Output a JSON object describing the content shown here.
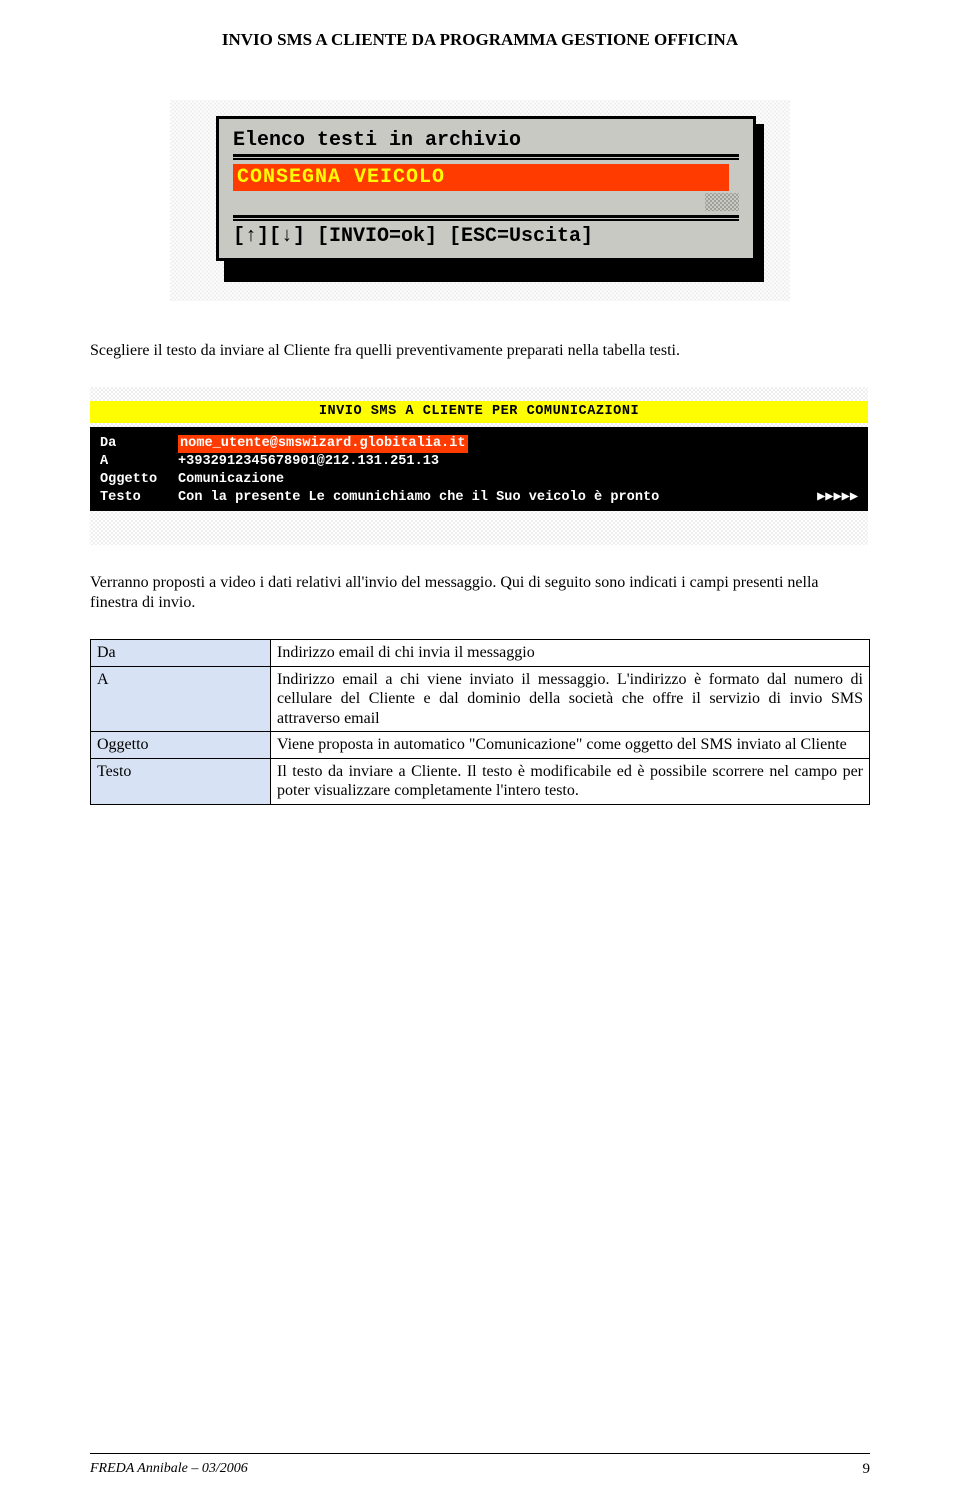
{
  "header": {
    "title": "INVIO SMS A CLIENTE DA PROGRAMMA GESTIONE OFFICINA"
  },
  "popup": {
    "title": "Elenco testi in archivio",
    "selected": "CONSEGNA VEICOLO",
    "instructions": "[↑][↓] [INVIO=ok] [ESC=Uscita]"
  },
  "para1": "Scegliere il testo da inviare al Cliente fra quelli preventivamente preparati nella tabella testi.",
  "form": {
    "banner": "INVIO SMS A CLIENTE PER COMUNICAZIONI",
    "rows": {
      "da": {
        "label": "Da",
        "value": "nome_utente@smswizard.globitalia.it"
      },
      "a": {
        "label": "A",
        "value": "+3932912345678901@212.131.251.13"
      },
      "oggetto": {
        "label": "Oggetto",
        "value": "Comunicazione"
      },
      "testo": {
        "label": "Testo",
        "value": "Con la presente Le comunichiamo che il Suo veicolo è pronto "
      }
    },
    "arrows": "▶▶▶▶▶"
  },
  "para2": "Verranno proposti a video i dati relativi all'invio del messaggio. Qui di seguito sono indicati i campi presenti nella finestra di invio.",
  "defs": [
    {
      "key": "Da",
      "val": "Indirizzo email di chi invia il messaggio"
    },
    {
      "key": "A",
      "val": "Indirizzo email a chi viene inviato il messaggio. L'indirizzo è formato dal numero di cellulare del Cliente e dal dominio della società che offre il servizio di invio SMS attraverso email"
    },
    {
      "key": "Oggetto",
      "val": "Viene proposta in automatico \"Comunicazione\" come oggetto del  SMS inviato al Cliente"
    },
    {
      "key": "Testo",
      "val": "Il testo da inviare a Cliente. Il testo è modificabile ed è possibile scorrere nel campo per poter visualizzare completamente l'intero testo."
    }
  ],
  "footer": {
    "left": "FREDA Annibale – 03/2006",
    "right": "9"
  }
}
